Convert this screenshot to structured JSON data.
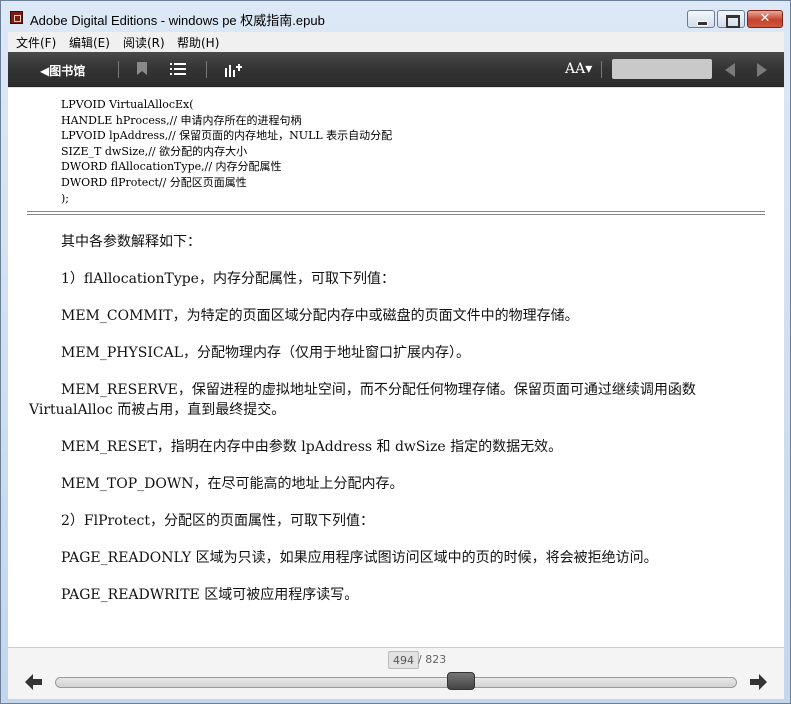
{
  "window": {
    "title": "Adobe Digital Editions - windows pe 权威指南.epub",
    "close_glyph": "✕"
  },
  "menu": [
    "文件(F)",
    "编辑(E)",
    "阅读(R)",
    "帮助(H)"
  ],
  "toolbar": {
    "library_label": "◀图书馆",
    "font_size_label": "AA▾",
    "search_value": "",
    "icons": [
      "bookmark-icon",
      "toc-icon",
      "stats-icon",
      "font-size-icon",
      "prev-page-icon",
      "next-page-icon"
    ]
  },
  "code_block": [
    "LPVOID VirtualAllocEx(",
    "HANDLE hProcess,// 申请内存所在的进程句柄",
    "LPVOID lpAddress,// 保留页面的内存地址，NULL 表示自动分配",
    "SIZE_T dwSize,// 欲分配的内存大小",
    "DWORD flAllocationType,// 内存分配属性",
    "DWORD flProtect// 分配区页面属性",
    ");"
  ],
  "paragraphs": [
    "其中各参数解释如下：",
    "1）flAllocationType，内存分配属性，可取下列值：",
    "MEM_COMMIT，为特定的页面区域分配内存中或磁盘的页面文件中的物理存储。",
    "MEM_PHYSICAL，分配物理内存（仅用于地址窗口扩展内存）。",
    "MEM_RESERVE，保留进程的虚拟地址空间，而不分配任何物理存储。保留页面可通过继续调用函数 VirtualAlloc 而被占用，直到最终提交。",
    "MEM_RESET，指明在内存中由参数 lpAddress 和 dwSize 指定的数据无效。",
    "MEM_TOP_DOWN，在尽可能高的地址上分配内存。",
    "2）FlProtect，分配区的页面属性，可取下列值：",
    "PAGE_READONLY 区域为只读，如果应用程序试图访问区域中的页的时候，将会被拒绝访问。",
    "PAGE_READWRITE 区域可被应用程序读写。"
  ],
  "pager": {
    "current_page": "494",
    "total_pages": "/ 823",
    "position_fraction": 0.6
  },
  "colors": {
    "toolbar_bg": "#333333",
    "close_button": "#c4432d"
  }
}
